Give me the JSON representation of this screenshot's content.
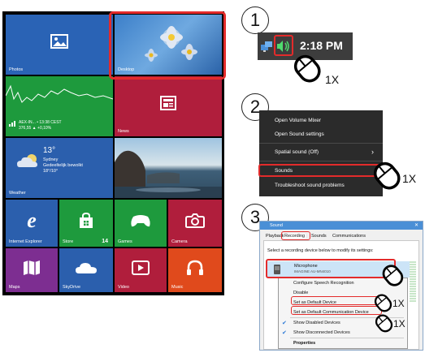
{
  "steps": {
    "one": "1",
    "two": "2",
    "three": "3"
  },
  "clicks": {
    "one": "1X",
    "two": "1X",
    "three": "1X"
  },
  "start": {
    "tiles": {
      "photos": "Photos",
      "desktop": "Desktop",
      "finance_line1": "AEX-IN... • 13:38 CEST",
      "finance_line2": "376,55 ▲ +0,10%",
      "news": "News",
      "weather_temp": "13°",
      "weather_city": "Sydney",
      "weather_desc": "Gedeeltelijk bewolkt",
      "weather_range": "18°/10°",
      "weather": "Weather",
      "ie": "Internet Explorer",
      "store": "Store",
      "store_count": "14",
      "games": "Games",
      "camera": "Camera",
      "maps": "Maps",
      "skydrive": "SkyDrive",
      "video": "Video",
      "music": "Music"
    }
  },
  "taskbar": {
    "time": "2:18 PM"
  },
  "context_menu": {
    "items": [
      "Open Volume Mixer",
      "Open Sound settings",
      "Spatial sound (Off)",
      "Sounds",
      "Troubleshoot sound problems"
    ]
  },
  "sound_dialog": {
    "title": "Sound",
    "close": "✕",
    "tabs": [
      "Playback",
      "Recording",
      "Sounds",
      "Communications"
    ],
    "instruction": "Select a recording device below to modify its settings:",
    "device_name": "Microphone",
    "device_sub": "IMAGINE AU-MN4010",
    "menu_items": [
      "Configure Speech Recognition",
      "Disable",
      "Set as Default Device",
      "Set as Default Communication Device",
      "Show Disabled Devices",
      "Show Disconnected Devices",
      "Properties"
    ]
  },
  "colors": {
    "red": "#e32b2b",
    "blue_tile": "#2b5fad",
    "green_tile": "#1e9a3d",
    "crimson_tile": "#b01e3c",
    "purple_tile": "#7d2e91"
  }
}
